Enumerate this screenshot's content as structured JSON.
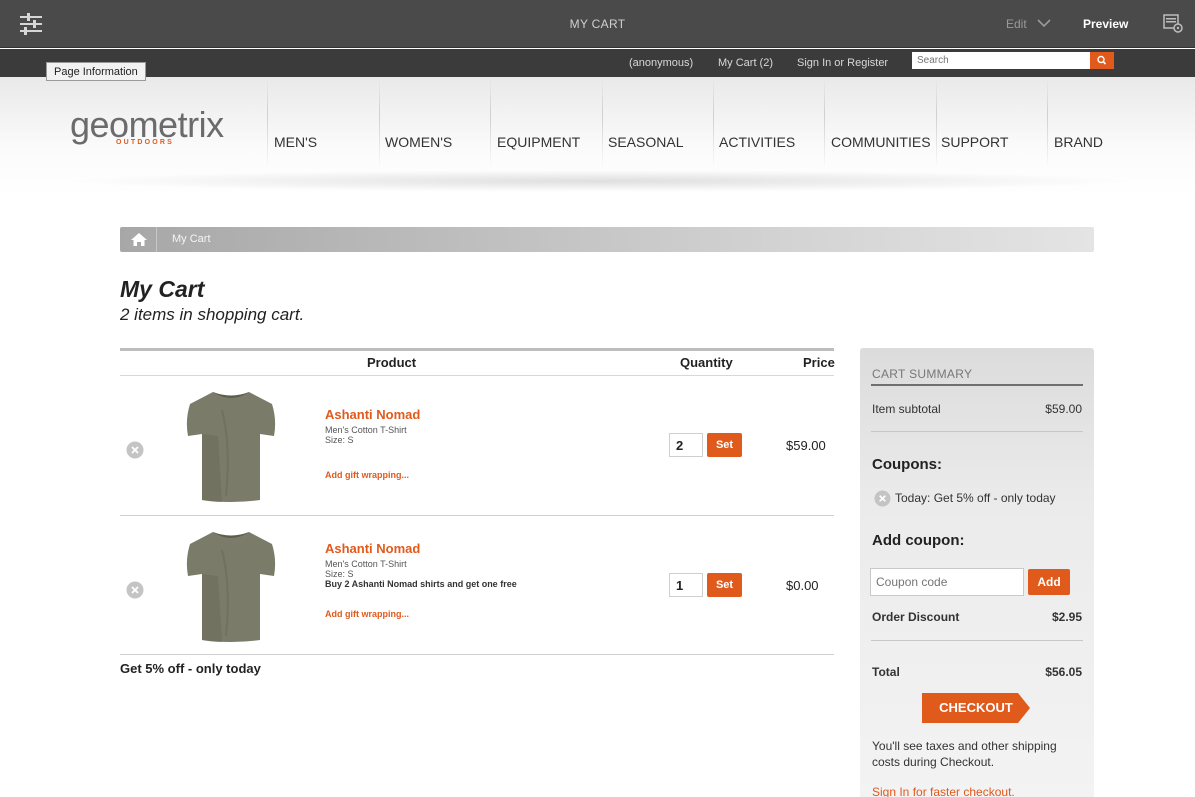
{
  "editor": {
    "title": "MY CART",
    "edit_label": "Edit",
    "preview_label": "Preview",
    "page_info_label": "Page Information"
  },
  "topnav": {
    "user": "(anonymous)",
    "cart_link": "My Cart (2)",
    "signin_link": "Sign In or Register",
    "search_placeholder": "Search"
  },
  "brand": {
    "logo_text": "geometrix",
    "logo_sub": "OUTDOORS"
  },
  "nav": {
    "items": [
      "MEN'S",
      "WOMEN'S",
      "EQUIPMENT",
      "SEASONAL",
      "ACTIVITIES",
      "COMMUNITIES",
      "SUPPORT",
      "BRAND"
    ]
  },
  "breadcrumb": {
    "current": "My Cart"
  },
  "page": {
    "title": "My Cart",
    "subtitle": "2 items in shopping cart."
  },
  "cart": {
    "headers": {
      "product": "Product",
      "quantity": "Quantity",
      "price": "Price"
    },
    "set_label": "Set",
    "items": [
      {
        "name": "Ashanti Nomad",
        "type": "Men's Cotton T-Shirt",
        "size": "Size: S",
        "deal": "",
        "gift": "Add gift wrapping...",
        "quantity": "2",
        "price": "$59.00"
      },
      {
        "name": "Ashanti Nomad",
        "type": "Men's Cotton T-Shirt",
        "size": "Size: S",
        "deal": "Buy 2 Ashanti Nomad shirts and get one free",
        "gift": "Add gift wrapping...",
        "quantity": "1",
        "price": "$0.00"
      }
    ],
    "promo": "Get 5% off - only today"
  },
  "summary": {
    "title": "CART SUMMARY",
    "subtotal_label": "Item subtotal",
    "subtotal_value": "$59.00",
    "coupons_heading": "Coupons:",
    "coupon_applied": "Today: Get 5% off - only today",
    "add_coupon_heading": "Add coupon:",
    "coupon_placeholder": "Coupon code",
    "add_label": "Add",
    "discount_label": "Order Discount",
    "discount_value": "$2.95",
    "total_label": "Total",
    "total_value": "$56.05",
    "checkout_label": "CHECKOUT",
    "note": "You'll see taxes and other shipping costs during Checkout.",
    "signin": "Sign In for faster checkout."
  },
  "colors": {
    "accent": "#e05a1c",
    "editor_bar": "#4a4a4a",
    "site_strip": "#3b3b3b"
  },
  "icons": [
    "sliders-icon",
    "chevron-down-icon",
    "sidepanel-icon",
    "search-icon",
    "home-icon",
    "remove-icon",
    "tshirt-image"
  ]
}
